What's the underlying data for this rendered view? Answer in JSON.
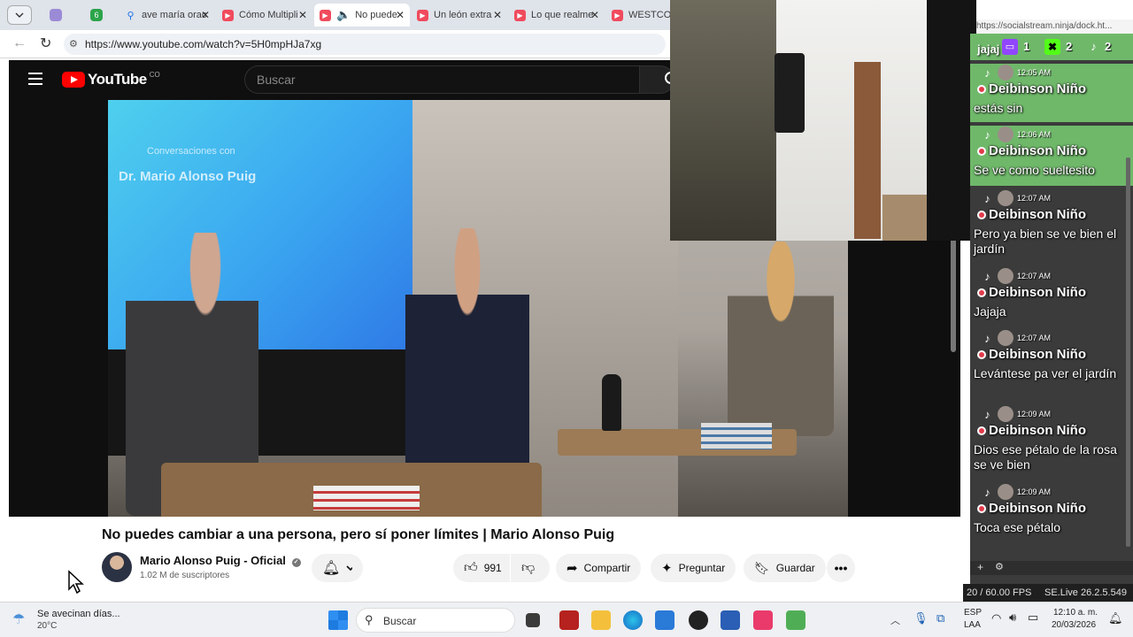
{
  "browser": {
    "tabs": [
      {
        "label": "ave maría orac"
      },
      {
        "label": "Cómo Multipli"
      },
      {
        "label": "No puede"
      },
      {
        "label": "Un león extra"
      },
      {
        "label": "Lo que realme"
      },
      {
        "label": "WESTCOL"
      }
    ],
    "extension_badge": "6",
    "url": "https://www.youtube.com/watch?v=5H0mpHJa7xg"
  },
  "youtube": {
    "logo_text": "YouTube",
    "region": "CO",
    "search_placeholder": "Buscar",
    "video_title": "No puedes cambiar a una persona, pero sí poner límites | Mario Alonso Puig",
    "video_overlay": {
      "line1": "Conversaciones con",
      "line2": "Dr. Mario Alonso Puig"
    },
    "channel_name": "Mario Alonso Puig - Oficial",
    "subscribers": "1.02 M de suscriptores",
    "likes": "991",
    "share_label": "Compartir",
    "ask_label": "Preguntar",
    "save_label": "Guardar"
  },
  "chat": {
    "url": "https://socialstream.ninja/dock.ht...",
    "header_partial": "jajaj",
    "platform_counts": {
      "twitch": "1",
      "kick": "2",
      "tiktok": "2"
    },
    "messages": [
      {
        "time": "12:05 AM",
        "name": "Deibinson Niño",
        "text": "estás sin"
      },
      {
        "time": "12:06 AM",
        "name": "Deibinson Niño",
        "text": "Se ve como sueltesito"
      },
      {
        "time": "12:07 AM",
        "name": "Deibinson Niño",
        "text": "Pero ya bien se ve bien el jardín"
      },
      {
        "time": "12:07 AM",
        "name": "Deibinson Niño",
        "text": "Jajaja"
      },
      {
        "time": "12:07 AM",
        "name": "Deibinson Niño",
        "text": "Levántese pa ver el jardín"
      },
      {
        "time": "12:09 AM",
        "name": "Deibinson Niño",
        "text": "Dios ese pétalo de la rosa se ve bien"
      },
      {
        "time": "12:09 AM",
        "name": "Deibinson Niño",
        "text": "Toca ese pétalo"
      }
    ],
    "fps": "20 / 60.00 FPS",
    "version": "SE.Live 26.2.5.549"
  },
  "taskbar": {
    "weather_text": "Se avecinan días...",
    "temperature": "20°C",
    "search_label": "Buscar",
    "language": "ESP",
    "layout": "LAA",
    "time": "12:10 a. m.",
    "date": "20/03/2026"
  },
  "colors": {
    "youtube_red": "#ff0000",
    "tiktok_highlight": "#6fb86a",
    "chat_bg": "#3b3b3b"
  }
}
